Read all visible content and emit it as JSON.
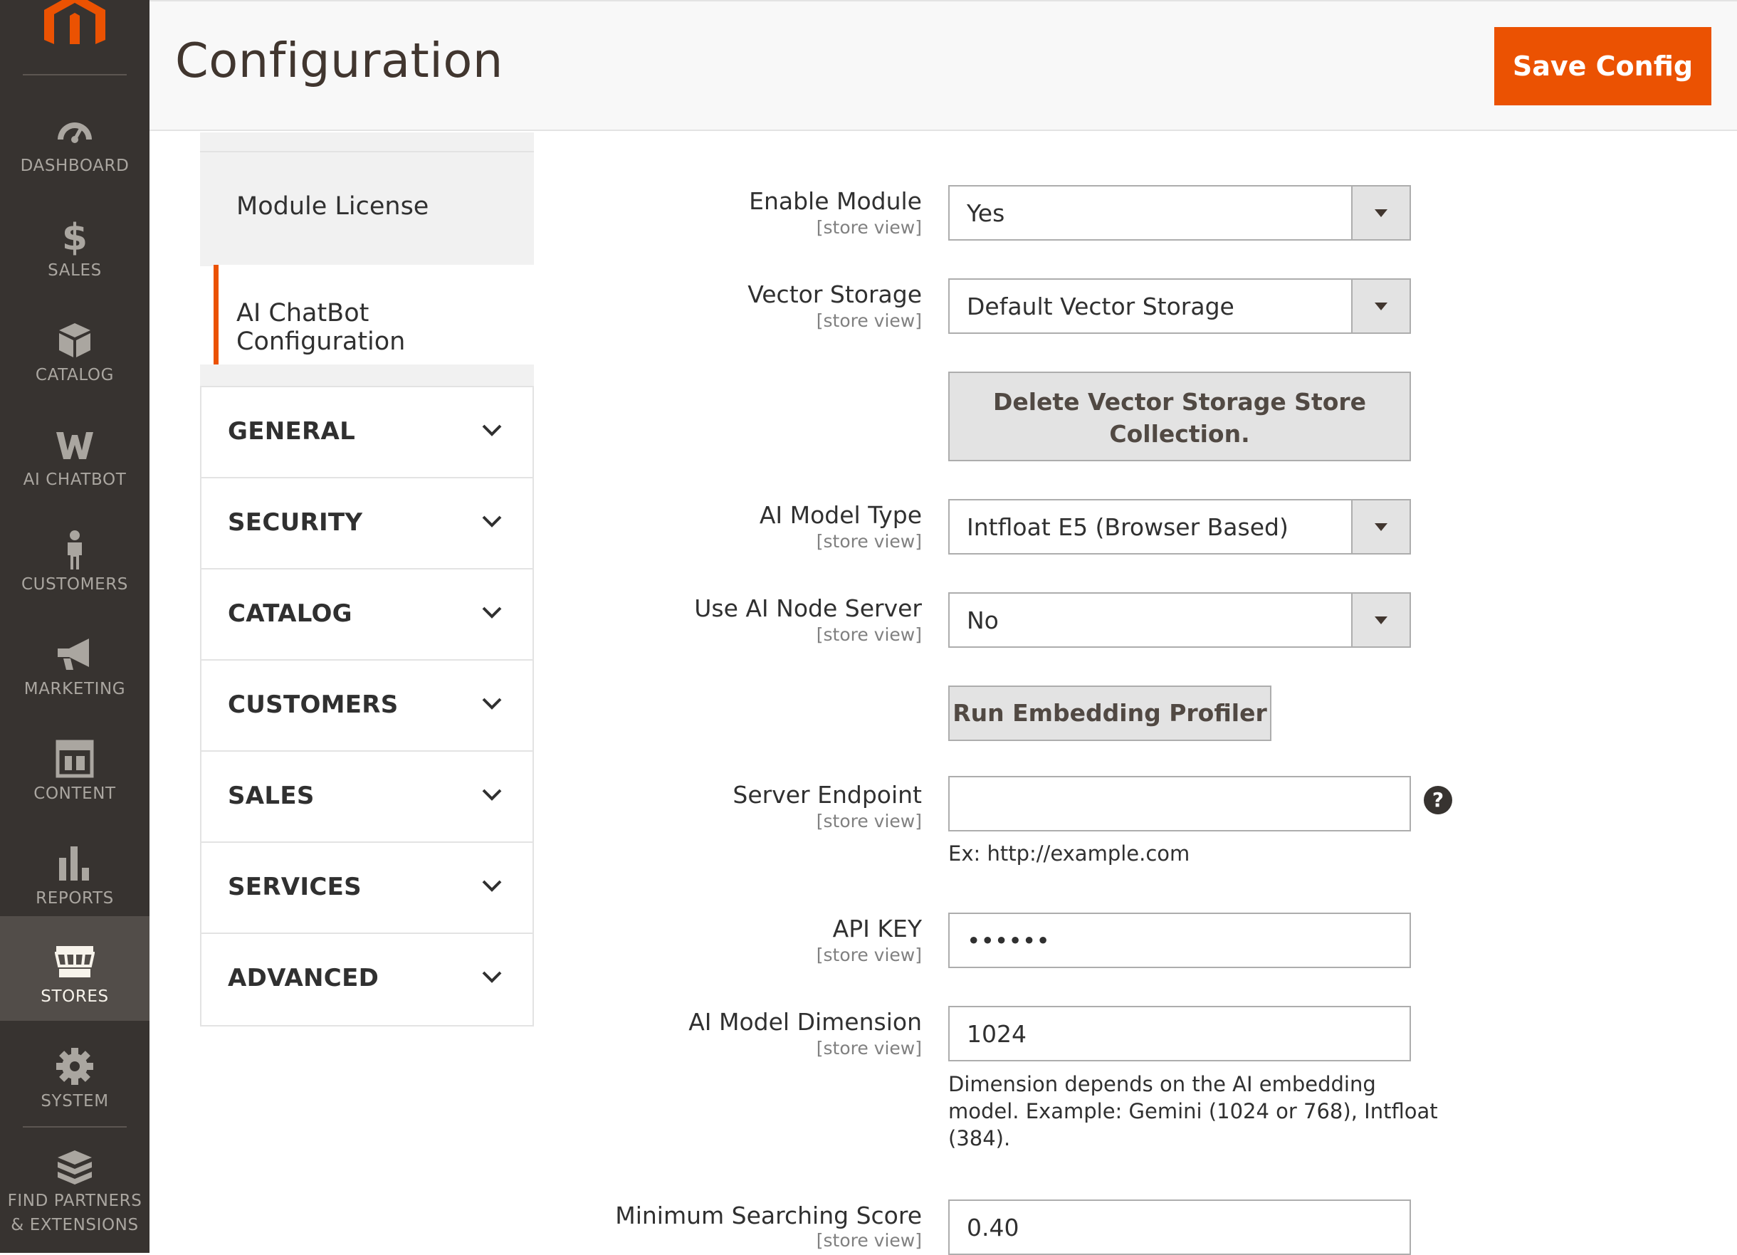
{
  "brand": {
    "accent": "#eb5202",
    "menu_bg": "#373330"
  },
  "menu": {
    "items": [
      {
        "label": "DASHBOARD",
        "icon": "dashboard-icon"
      },
      {
        "label": "SALES",
        "icon": "dollar-icon"
      },
      {
        "label": "CATALOG",
        "icon": "box-icon"
      },
      {
        "label": "AI CHATBOT",
        "icon": "ai-chatbot-icon"
      },
      {
        "label": "CUSTOMERS",
        "icon": "person-icon"
      },
      {
        "label": "MARKETING",
        "icon": "megaphone-icon"
      },
      {
        "label": "CONTENT",
        "icon": "layout-icon"
      },
      {
        "label": "REPORTS",
        "icon": "bar-chart-icon"
      },
      {
        "label": "STORES",
        "icon": "store-icon"
      },
      {
        "label": "SYSTEM",
        "icon": "gear-icon"
      },
      {
        "label_line1": "FIND PARTNERS",
        "label_line2": "& EXTENSIONS",
        "icon": "extensions-icon"
      }
    ]
  },
  "header": {
    "title": "Configuration",
    "save_label": "Save Config"
  },
  "tabs": {
    "module_license": "Module License",
    "ai_chatbot_config": "AI ChatBot Configuration",
    "sections": [
      "GENERAL",
      "SECURITY",
      "CATALOG",
      "CUSTOMERS",
      "SALES",
      "SERVICES",
      "ADVANCED"
    ]
  },
  "form": {
    "scope": "[store view]",
    "enable_module": {
      "label": "Enable Module",
      "value": "Yes"
    },
    "vector_storage": {
      "label": "Vector Storage",
      "value": "Default Vector Storage"
    },
    "delete_button": {
      "line1": "Delete Vector Storage Store",
      "line2": "Collection."
    },
    "ai_model_type": {
      "label": "AI Model Type",
      "value": "Intfloat E5 (Browser Based)"
    },
    "use_node_server": {
      "label": "Use AI Node Server",
      "value": "No"
    },
    "run_profiler": "Run Embedding Profiler",
    "server_endpoint": {
      "label": "Server Endpoint",
      "value": "",
      "note": "Ex: http://example.com",
      "help": "?"
    },
    "api_key": {
      "label": "API KEY",
      "value": "••••••"
    },
    "ai_model_dimension": {
      "label": "AI Model Dimension",
      "value": "1024",
      "note_line1": "Dimension depends on the AI embedding",
      "note_line2": "model. Example: Gemini (1024 or 768), Intfloat",
      "note_line3": "(384)."
    },
    "min_search_score": {
      "label": "Minimum Searching Score",
      "value": "0.40"
    }
  }
}
